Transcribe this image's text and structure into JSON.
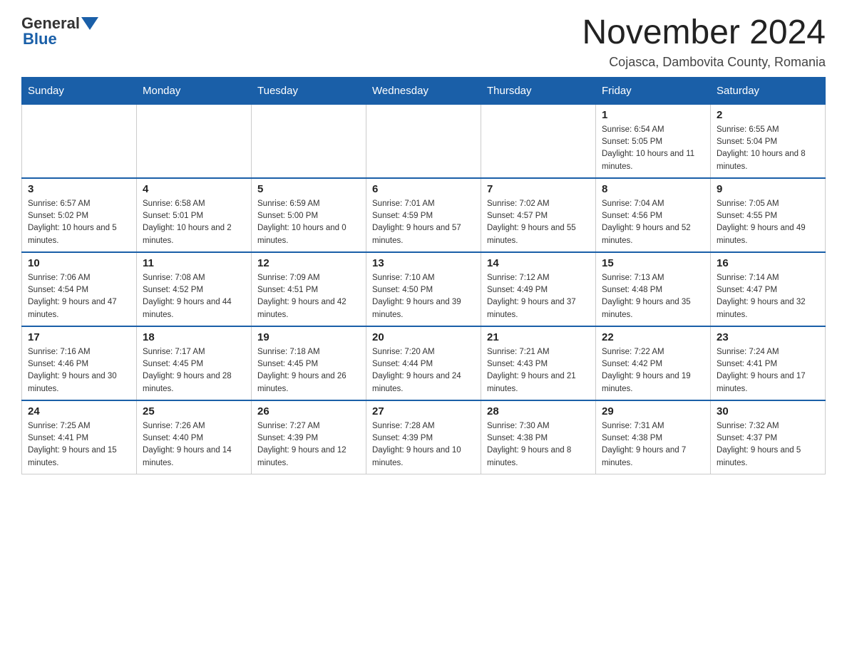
{
  "logo": {
    "general": "General",
    "blue": "Blue"
  },
  "title": "November 2024",
  "subtitle": "Cojasca, Dambovita County, Romania",
  "weekdays": [
    "Sunday",
    "Monday",
    "Tuesday",
    "Wednesday",
    "Thursday",
    "Friday",
    "Saturday"
  ],
  "weeks": [
    [
      {
        "day": "",
        "info": ""
      },
      {
        "day": "",
        "info": ""
      },
      {
        "day": "",
        "info": ""
      },
      {
        "day": "",
        "info": ""
      },
      {
        "day": "",
        "info": ""
      },
      {
        "day": "1",
        "info": "Sunrise: 6:54 AM\nSunset: 5:05 PM\nDaylight: 10 hours and 11 minutes."
      },
      {
        "day": "2",
        "info": "Sunrise: 6:55 AM\nSunset: 5:04 PM\nDaylight: 10 hours and 8 minutes."
      }
    ],
    [
      {
        "day": "3",
        "info": "Sunrise: 6:57 AM\nSunset: 5:02 PM\nDaylight: 10 hours and 5 minutes."
      },
      {
        "day": "4",
        "info": "Sunrise: 6:58 AM\nSunset: 5:01 PM\nDaylight: 10 hours and 2 minutes."
      },
      {
        "day": "5",
        "info": "Sunrise: 6:59 AM\nSunset: 5:00 PM\nDaylight: 10 hours and 0 minutes."
      },
      {
        "day": "6",
        "info": "Sunrise: 7:01 AM\nSunset: 4:59 PM\nDaylight: 9 hours and 57 minutes."
      },
      {
        "day": "7",
        "info": "Sunrise: 7:02 AM\nSunset: 4:57 PM\nDaylight: 9 hours and 55 minutes."
      },
      {
        "day": "8",
        "info": "Sunrise: 7:04 AM\nSunset: 4:56 PM\nDaylight: 9 hours and 52 minutes."
      },
      {
        "day": "9",
        "info": "Sunrise: 7:05 AM\nSunset: 4:55 PM\nDaylight: 9 hours and 49 minutes."
      }
    ],
    [
      {
        "day": "10",
        "info": "Sunrise: 7:06 AM\nSunset: 4:54 PM\nDaylight: 9 hours and 47 minutes."
      },
      {
        "day": "11",
        "info": "Sunrise: 7:08 AM\nSunset: 4:52 PM\nDaylight: 9 hours and 44 minutes."
      },
      {
        "day": "12",
        "info": "Sunrise: 7:09 AM\nSunset: 4:51 PM\nDaylight: 9 hours and 42 minutes."
      },
      {
        "day": "13",
        "info": "Sunrise: 7:10 AM\nSunset: 4:50 PM\nDaylight: 9 hours and 39 minutes."
      },
      {
        "day": "14",
        "info": "Sunrise: 7:12 AM\nSunset: 4:49 PM\nDaylight: 9 hours and 37 minutes."
      },
      {
        "day": "15",
        "info": "Sunrise: 7:13 AM\nSunset: 4:48 PM\nDaylight: 9 hours and 35 minutes."
      },
      {
        "day": "16",
        "info": "Sunrise: 7:14 AM\nSunset: 4:47 PM\nDaylight: 9 hours and 32 minutes."
      }
    ],
    [
      {
        "day": "17",
        "info": "Sunrise: 7:16 AM\nSunset: 4:46 PM\nDaylight: 9 hours and 30 minutes."
      },
      {
        "day": "18",
        "info": "Sunrise: 7:17 AM\nSunset: 4:45 PM\nDaylight: 9 hours and 28 minutes."
      },
      {
        "day": "19",
        "info": "Sunrise: 7:18 AM\nSunset: 4:45 PM\nDaylight: 9 hours and 26 minutes."
      },
      {
        "day": "20",
        "info": "Sunrise: 7:20 AM\nSunset: 4:44 PM\nDaylight: 9 hours and 24 minutes."
      },
      {
        "day": "21",
        "info": "Sunrise: 7:21 AM\nSunset: 4:43 PM\nDaylight: 9 hours and 21 minutes."
      },
      {
        "day": "22",
        "info": "Sunrise: 7:22 AM\nSunset: 4:42 PM\nDaylight: 9 hours and 19 minutes."
      },
      {
        "day": "23",
        "info": "Sunrise: 7:24 AM\nSunset: 4:41 PM\nDaylight: 9 hours and 17 minutes."
      }
    ],
    [
      {
        "day": "24",
        "info": "Sunrise: 7:25 AM\nSunset: 4:41 PM\nDaylight: 9 hours and 15 minutes."
      },
      {
        "day": "25",
        "info": "Sunrise: 7:26 AM\nSunset: 4:40 PM\nDaylight: 9 hours and 14 minutes."
      },
      {
        "day": "26",
        "info": "Sunrise: 7:27 AM\nSunset: 4:39 PM\nDaylight: 9 hours and 12 minutes."
      },
      {
        "day": "27",
        "info": "Sunrise: 7:28 AM\nSunset: 4:39 PM\nDaylight: 9 hours and 10 minutes."
      },
      {
        "day": "28",
        "info": "Sunrise: 7:30 AM\nSunset: 4:38 PM\nDaylight: 9 hours and 8 minutes."
      },
      {
        "day": "29",
        "info": "Sunrise: 7:31 AM\nSunset: 4:38 PM\nDaylight: 9 hours and 7 minutes."
      },
      {
        "day": "30",
        "info": "Sunrise: 7:32 AM\nSunset: 4:37 PM\nDaylight: 9 hours and 5 minutes."
      }
    ]
  ]
}
